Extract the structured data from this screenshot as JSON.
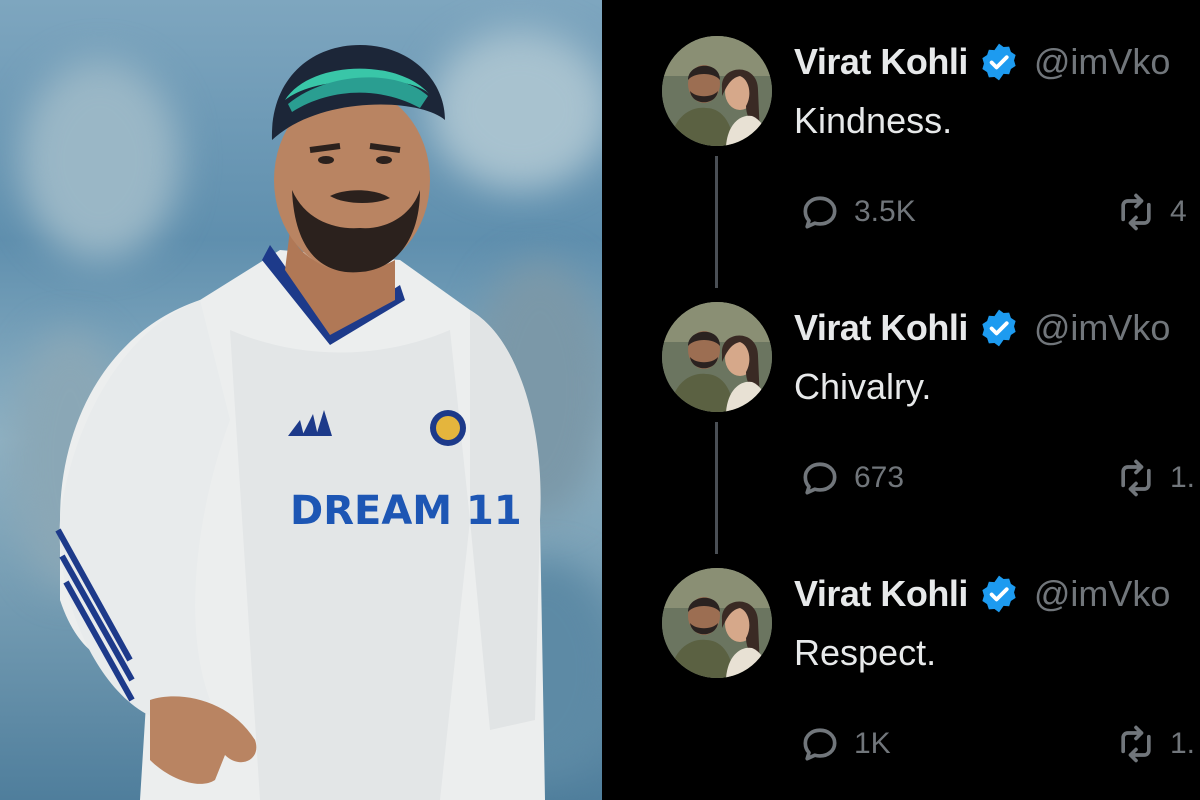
{
  "photo": {
    "sponsor_text": "DREAM 11",
    "subject": "cricket-player-photo"
  },
  "tweets": [
    {
      "name": "Virat Kohli",
      "handle": "@imVko",
      "text": "Kindness.",
      "replies": "3.5K",
      "retweets": "4"
    },
    {
      "name": "Virat Kohli",
      "handle": "@imVko",
      "text": "Chivalry.",
      "replies": "673",
      "retweets": "1."
    },
    {
      "name": "Virat Kohli",
      "handle": "@imVko",
      "text": "Respect.",
      "replies": "1K",
      "retweets": "1."
    }
  ],
  "colors": {
    "background": "#000000",
    "text_primary": "#e7e9ea",
    "text_secondary": "#71767b",
    "verified_blue": "#1d9bf0"
  },
  "icons": {
    "reply": "reply-icon",
    "retweet": "retweet-icon",
    "verified": "verified-badge-icon"
  }
}
